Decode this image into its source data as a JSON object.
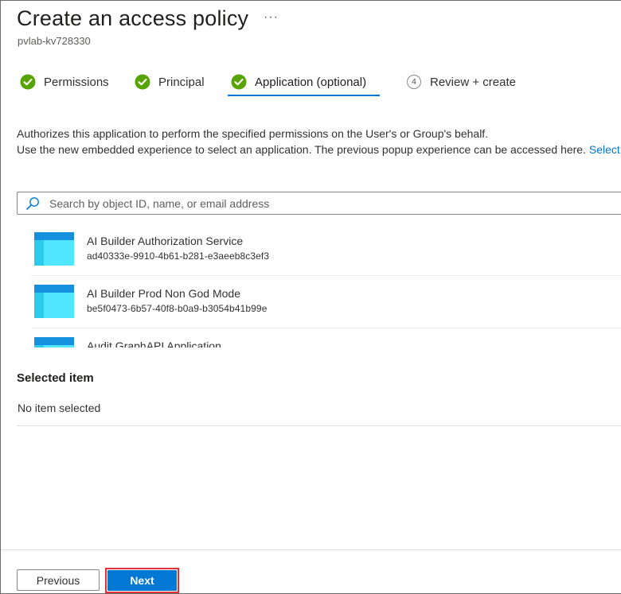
{
  "header": {
    "title": "Create an access policy",
    "more_label": "···",
    "subtitle": "pvlab-kv728330"
  },
  "tabs": [
    {
      "label": "Permissions",
      "state": "complete",
      "icon": "check-circle-icon"
    },
    {
      "label": "Principal",
      "state": "complete",
      "icon": "check-circle-icon"
    },
    {
      "label": "Application (optional)",
      "state": "complete-active",
      "icon": "check-circle-icon"
    },
    {
      "label": "Review + create",
      "state": "pending",
      "step": "4"
    }
  ],
  "description": {
    "line1": "Authorizes this application to perform the specified permissions on the User's or Group's behalf.",
    "line2": "Use the new embedded experience to select an application. The previous popup experience can be accessed here.",
    "link": "Select"
  },
  "search": {
    "placeholder": "Search by object ID, name, or email address",
    "value": ""
  },
  "applications": [
    {
      "name": "AI Builder Authorization Service",
      "id": "ad40333e-9910-4b61-b281-e3aeeb8c3ef3"
    },
    {
      "name": "AI Builder Prod Non God Mode",
      "id": "be5f0473-6b57-40f8-b0a9-b3054b41b99e"
    },
    {
      "name": "Audit GraphAPI Application",
      "id": ""
    }
  ],
  "selected": {
    "title": "Selected item",
    "empty_text": "No item selected"
  },
  "footer": {
    "previous_label": "Previous",
    "next_label": "Next"
  },
  "colors": {
    "accent": "#0078d4",
    "success": "#57a300",
    "highlight_border": "#e0313a"
  }
}
